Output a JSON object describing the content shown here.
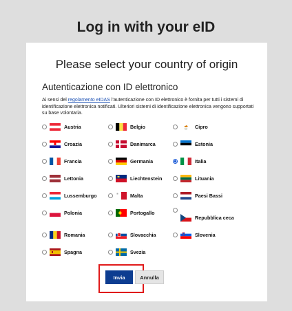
{
  "page": {
    "title": "Log in with your eID",
    "heading": "Please select your country of origin",
    "subheading": "Autenticazione con ID elettronico",
    "info_before": "Ai sensi del ",
    "info_link": "regolamento eIDAS",
    "info_after": " l'autenticazione con ID elettronico è fornita per tutti i sistemi di identificazione elettronica notificati. Ulteriori sistemi di identificazione elettronica vengono supportati su base volontaria."
  },
  "countries": [
    {
      "label": "Austria",
      "selected": false
    },
    {
      "label": "Belgio",
      "selected": false
    },
    {
      "label": "Cipro",
      "selected": false
    },
    {
      "label": "Croazia",
      "selected": false
    },
    {
      "label": "Danimarca",
      "selected": false
    },
    {
      "label": "Estonia",
      "selected": false
    },
    {
      "label": "Francia",
      "selected": false
    },
    {
      "label": "Germania",
      "selected": false
    },
    {
      "label": "Italia",
      "selected": true
    },
    {
      "label": "Lettonia",
      "selected": false
    },
    {
      "label": "Liechtenstein",
      "selected": false
    },
    {
      "label": "Lituania",
      "selected": false
    },
    {
      "label": "Lussemburgo",
      "selected": false
    },
    {
      "label": "Malta",
      "selected": false
    },
    {
      "label": "Paesi Bassi",
      "selected": false
    },
    {
      "label": "Polonia",
      "selected": false
    },
    {
      "label": "Portogallo",
      "selected": false
    },
    {
      "label": "Repubblica ceca",
      "selected": false
    },
    {
      "label": "Romania",
      "selected": false
    },
    {
      "label": "Slovacchia",
      "selected": false
    },
    {
      "label": "Slovenia",
      "selected": false
    },
    {
      "label": "Spagna",
      "selected": false
    },
    {
      "label": "Svezia",
      "selected": false
    }
  ],
  "buttons": {
    "submit_label": "Invia",
    "cancel_label": "Annulla"
  },
  "colors": {
    "submit_bg": "#0d3d91",
    "highlight": "#e01919"
  }
}
